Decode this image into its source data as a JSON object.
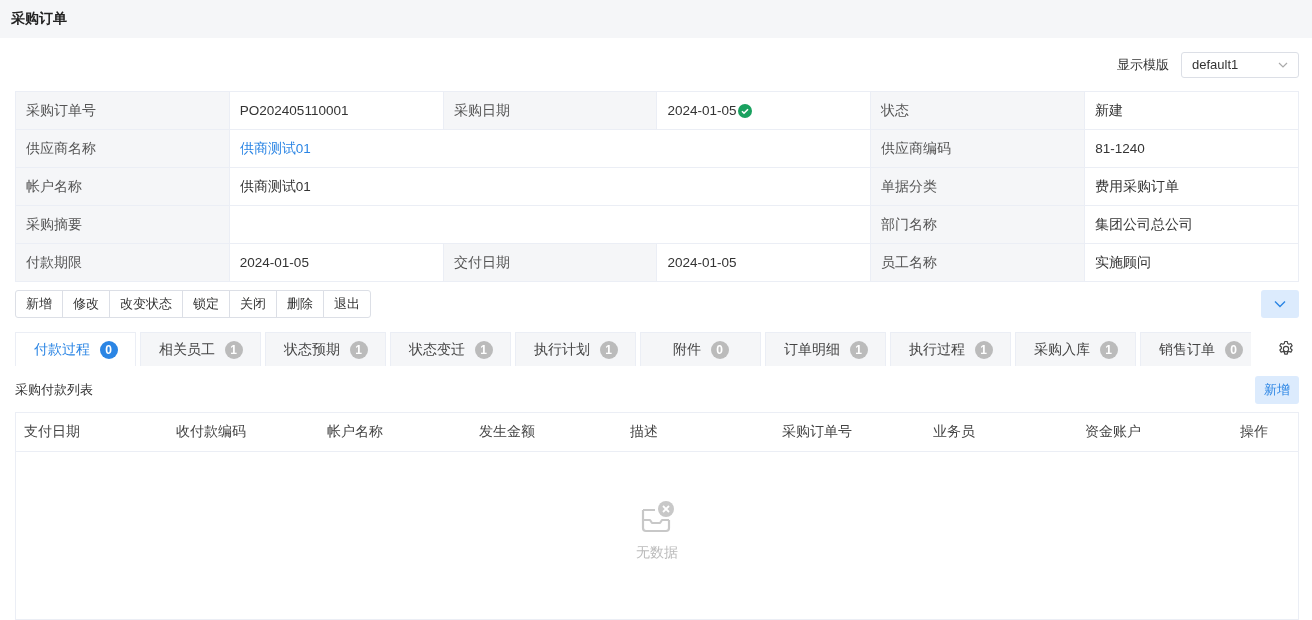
{
  "page_title": "采购订单",
  "template": {
    "label": "显示模版",
    "value": "default1"
  },
  "info_rows": [
    [
      {
        "kind": "label",
        "text": "采购订单号"
      },
      {
        "kind": "value",
        "text": "PO202405110001"
      },
      {
        "kind": "label",
        "text": "采购日期"
      },
      {
        "kind": "value",
        "text": "2024-01-05",
        "verified": true
      },
      {
        "kind": "label",
        "text": "状态"
      },
      {
        "kind": "value",
        "text": "新建"
      }
    ],
    [
      {
        "kind": "label",
        "text": "供应商名称"
      },
      {
        "kind": "link",
        "text": "供商测试01"
      },
      {
        "kind": "label",
        "text": "供应商编码"
      },
      {
        "kind": "value",
        "text": "81-1240"
      }
    ],
    [
      {
        "kind": "label",
        "text": "帐户名称"
      },
      {
        "kind": "value",
        "text": "供商测试01"
      },
      {
        "kind": "label",
        "text": "单据分类"
      },
      {
        "kind": "value",
        "text": "费用采购订单"
      }
    ],
    [
      {
        "kind": "label",
        "text": "采购摘要"
      },
      {
        "kind": "value"
      },
      {
        "kind": "label",
        "text": "部门名称"
      },
      {
        "kind": "value",
        "text": "集团公司总公司"
      }
    ],
    [
      {
        "kind": "label",
        "text": "付款期限"
      },
      {
        "kind": "value",
        "text": "2024-01-05"
      },
      {
        "kind": "label",
        "text": "交付日期"
      },
      {
        "kind": "value",
        "text": "2024-01-05"
      },
      {
        "kind": "label",
        "text": "员工名称"
      },
      {
        "kind": "value",
        "text": "实施顾问"
      }
    ]
  ],
  "actions": [
    "新增",
    "修改",
    "改变状态",
    "锁定",
    "关闭",
    "删除",
    "退出"
  ],
  "tabs": [
    {
      "label": "付款过程",
      "count": "0",
      "selected": true
    },
    {
      "label": "相关员工",
      "count": "1",
      "selected": false
    },
    {
      "label": "状态预期",
      "count": "1",
      "selected": false
    },
    {
      "label": "状态变迁",
      "count": "1",
      "selected": false
    },
    {
      "label": "执行计划",
      "count": "1",
      "selected": false
    },
    {
      "label": "附件",
      "count": "0",
      "selected": false
    },
    {
      "label": "订单明细",
      "count": "1",
      "selected": false
    },
    {
      "label": "执行过程",
      "count": "1",
      "selected": false
    },
    {
      "label": "采购入库",
      "count": "1",
      "selected": false
    },
    {
      "label": "销售订单",
      "count": "0",
      "selected": false
    }
  ],
  "section": {
    "title": "采购付款列表",
    "add_button": "新增"
  },
  "table": {
    "columns": [
      "支付日期",
      "收付款编码",
      "帐户名称",
      "发生金额",
      "描述",
      "采购订单号",
      "业务员",
      "资金账户",
      "操作"
    ],
    "empty_text": "无数据"
  }
}
